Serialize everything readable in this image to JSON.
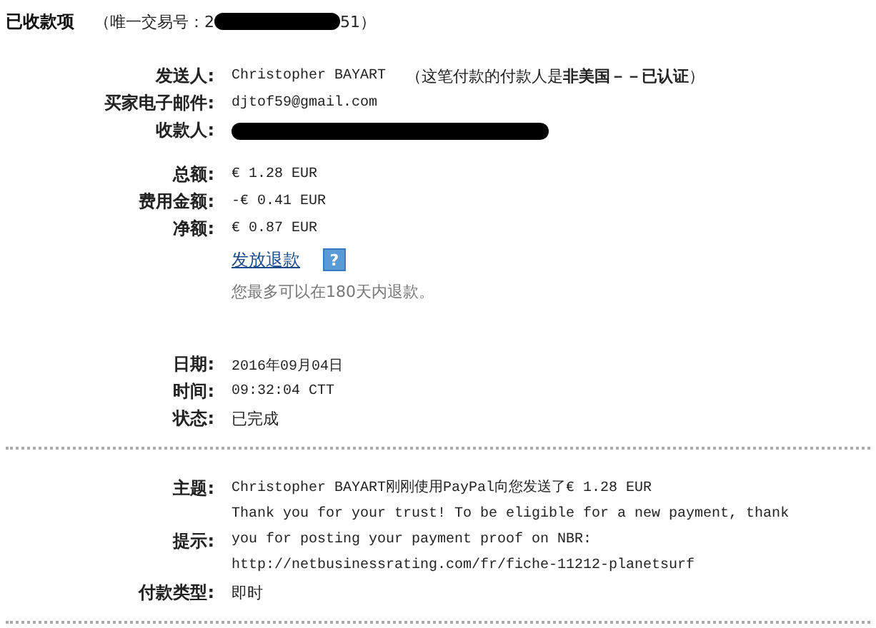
{
  "header": {
    "title": "已收款项",
    "transaction_prefix": "（唯一交易号：2",
    "transaction_suffix": "51）"
  },
  "party": [
    {
      "label": "发送人:",
      "value": "Christopher BAYART",
      "note": "（这笔付款的付款人是**非美国－－已认证**）",
      "redacted": false
    },
    {
      "label": "买家电子邮件:",
      "value": "djtof59@gmail.com",
      "redacted": false
    },
    {
      "label": "收款人:",
      "redacted": true
    }
  ],
  "amounts": [
    {
      "label": "总额:",
      "value": "€ 1.28 EUR"
    },
    {
      "label": "费用金额:",
      "value": "-€ 0.41 EUR"
    },
    {
      "label": "净额:",
      "value": "€ 0.87 EUR"
    }
  ],
  "refund": {
    "link": "发放退款",
    "help": "?",
    "note": "您最多可以在180天内退款。"
  },
  "details": [
    {
      "label": "日期:",
      "value": "2016年09月04日"
    },
    {
      "label": "时间:",
      "value": "09:32:04 CTT"
    },
    {
      "label": "状态:",
      "value": "已完成",
      "kind": "plain"
    }
  ],
  "message": [
    {
      "label": "主题:",
      "value": "Christopher BAYART刚刚使用PayPal向您发送了€ 1.28 EUR",
      "kind": "mono"
    },
    {
      "label": "提示:",
      "value": "Thank you for your trust! To be eligible for a new payment, thank you for posting your payment proof on NBR: http://netbusinessrating.com/fr/fiche-11212-planetsurf",
      "kind": "mono"
    },
    {
      "label": "付款类型:",
      "value": "即时",
      "kind": "plain"
    }
  ]
}
